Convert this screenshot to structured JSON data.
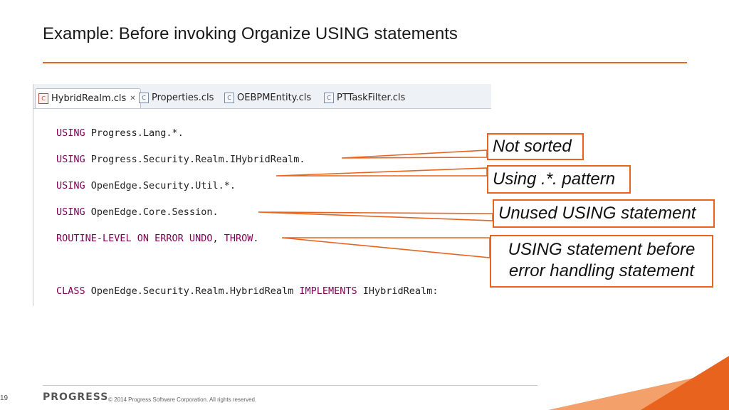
{
  "slide": {
    "title": "Example: Before invoking Organize USING statements",
    "page_number": "19"
  },
  "editor": {
    "tabs": [
      {
        "label": "HybridRealm.cls",
        "icon": "class-file-icon",
        "active": true,
        "close_glyph": "✕"
      },
      {
        "label": "Properties.cls",
        "icon": "class-file-icon",
        "active": false
      },
      {
        "label": "OEBPMEntity.cls",
        "icon": "class-file-icon",
        "active": false
      },
      {
        "label": "PTTaskFilter.cls",
        "icon": "class-file-icon",
        "active": false
      }
    ],
    "lines": [
      {
        "kw": "USING",
        "rest": " Progress.Lang.*."
      },
      {
        "kw": "USING",
        "rest": " Progress.Security.Realm.IHybridRealm."
      },
      {
        "kw": "USING",
        "rest": " OpenEdge.Security.Util.*."
      },
      {
        "kw": "USING",
        "rest": " OpenEdge.Core.Session."
      },
      {
        "kw": "ROUTINE-LEVEL ON ERROR UNDO",
        "mid": ", ",
        "kw2": "THROW",
        "rest": "."
      },
      {
        "kw": "CLASS",
        "rest": " OpenEdge.Security.Realm.HybridRealm ",
        "kw2": "IMPLEMENTS",
        "rest2": " IHybridRealm:"
      }
    ],
    "colors": {
      "keyword": "#7f0055",
      "text": "#222222"
    }
  },
  "callouts": {
    "not_sorted": "Not sorted",
    "pattern": "Using .*. pattern",
    "unused": "Unused USING statement",
    "before_error": "USING statement before error handling statement"
  },
  "footer": {
    "logo": "PROGRESS",
    "copyright": "© 2014 Progress Software Corporation. All rights reserved."
  },
  "colors": {
    "accent": "#e8641e"
  }
}
